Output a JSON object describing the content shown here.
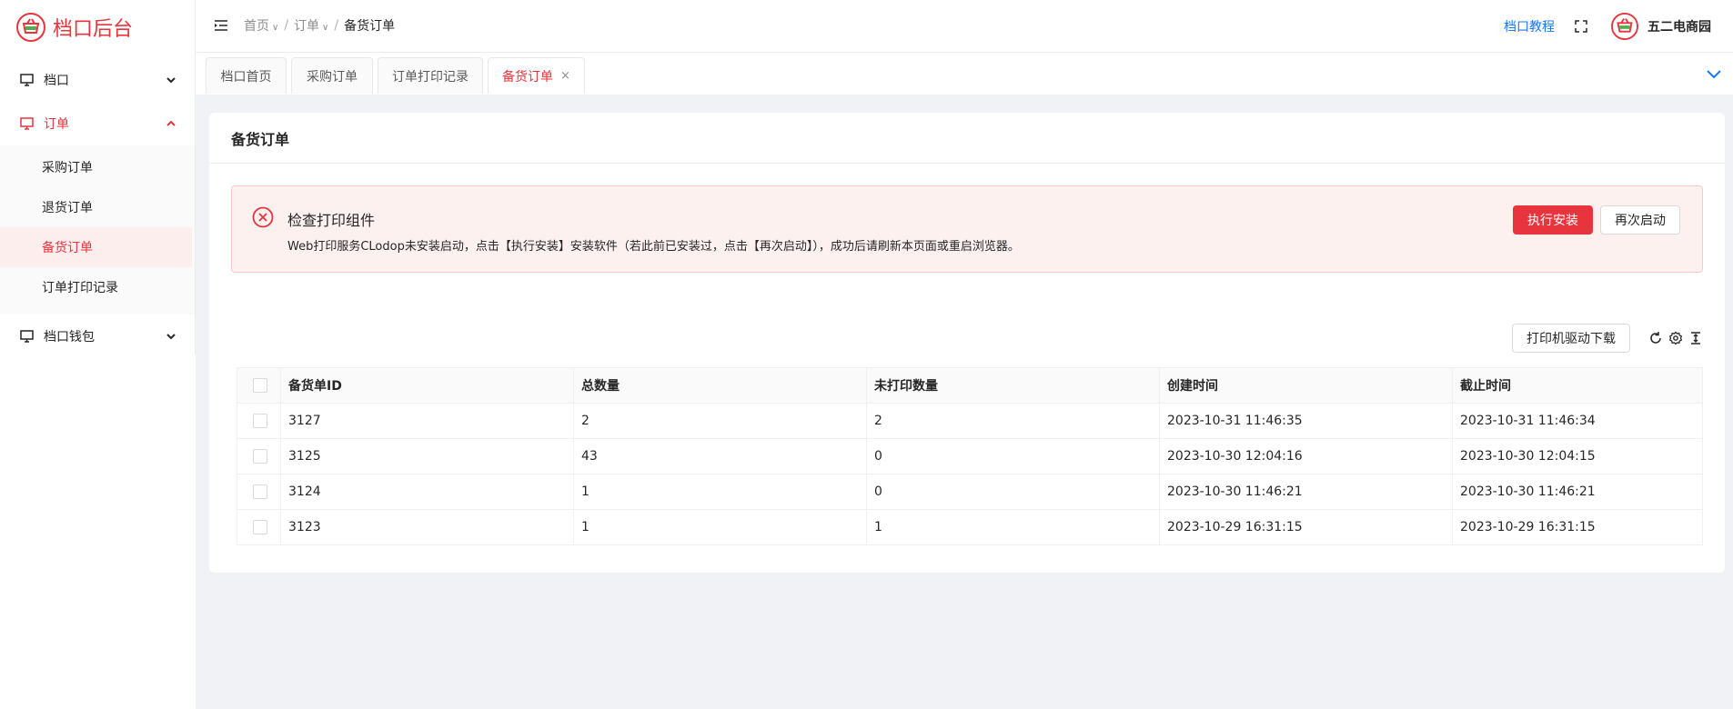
{
  "brand": {
    "name": "档口后台"
  },
  "sidebar": {
    "menu": [
      {
        "label": "档口",
        "icon": "monitor-icon"
      },
      {
        "label": "订单",
        "icon": "monitor-icon"
      },
      {
        "label": "档口钱包",
        "icon": "monitor-icon"
      }
    ],
    "order_submenu": [
      "采购订单",
      "退货订单",
      "备货订单",
      "订单打印记录"
    ],
    "active_sub": "备货订单"
  },
  "header": {
    "breadcrumb": [
      "首页",
      "订单",
      "备货订单"
    ],
    "tutorial_link": "档口教程",
    "username": "五二电商园"
  },
  "tabs": [
    {
      "label": "档口首页"
    },
    {
      "label": "采购订单"
    },
    {
      "label": "订单打印记录"
    },
    {
      "label": "备货订单",
      "active": true
    }
  ],
  "page": {
    "title": "备货订单",
    "alert": {
      "title": "检查打印组件",
      "description": "Web打印服务CLodop未安装启动，点击【执行安装】安装软件（若此前已安装过，点击【再次启动】），成功后请刷新本页面或重启浏览器。",
      "install_button": "执行安装",
      "restart_button": "再次启动"
    },
    "driver_button": "打印机驱动下载",
    "table": {
      "columns": [
        "备货单ID",
        "总数量",
        "未打印数量",
        "创建时间",
        "截止时间"
      ],
      "rows": [
        [
          "3127",
          "2",
          "2",
          "2023-10-31 11:46:35",
          "2023-10-31 11:46:34"
        ],
        [
          "3125",
          "43",
          "0",
          "2023-10-30 12:04:16",
          "2023-10-30 12:04:15"
        ],
        [
          "3124",
          "1",
          "0",
          "2023-10-30 11:46:21",
          "2023-10-30 11:46:21"
        ],
        [
          "3123",
          "1",
          "1",
          "2023-10-29 16:31:15",
          "2023-10-29 16:31:15"
        ]
      ]
    }
  },
  "colors": {
    "accent": "#e8343c",
    "link": "#1677ff"
  }
}
